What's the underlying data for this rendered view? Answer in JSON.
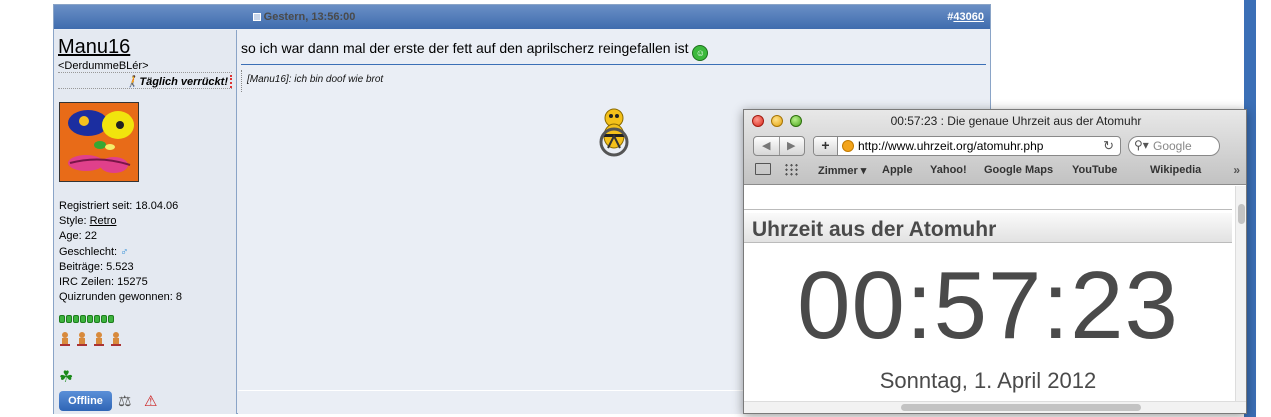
{
  "post": {
    "date": "Gestern, 13:56:00",
    "number_prefix": "#",
    "number": "43060"
  },
  "user": {
    "name": "Manu16",
    "title": "<DerdummeBLér>",
    "status": "Täglich verrückt!",
    "info": {
      "registered_label": "Registriert seit:",
      "registered": "18.04.06",
      "style_label": "Style:",
      "style": "Retro",
      "age_label": "Age:",
      "age": "22",
      "gender_label": "Geschlecht:",
      "gender_symbol": "♂",
      "posts_label": "Beiträge:",
      "posts": "5.523",
      "irc_label": "IRC Zeilen:",
      "irc": "15275",
      "quiz_label": "Quizrunden gewonnen:",
      "quiz": "8"
    },
    "offline_label": "Offline"
  },
  "message": {
    "text": "so ich war dann mal der erste der fett auf den aprilscherz reingefallen ist",
    "signature": "[Manu16]: ich bin doof wie brot"
  },
  "browser": {
    "window_title": "00:57:23 : Die genaue Uhrzeit aus der Atomuhr",
    "url": "http://www.uhrzeit.org/atomuhr.php",
    "search_placeholder": "Google",
    "bookmarks": [
      "Zimmer ▾",
      "Apple",
      "Yahoo!",
      "Google Maps",
      "YouTube",
      "Wikipedia"
    ],
    "more": "»",
    "page_heading": "Uhrzeit aus der Atomuhr",
    "clock": "00:57:23",
    "date": "Sonntag, 1. April 2012"
  },
  "colors": {
    "header_blue": "#3f6cae",
    "accent_blue": "#3b6fb6",
    "offline_button": "#2f65b5",
    "quiz_green": "#3eb33e"
  }
}
